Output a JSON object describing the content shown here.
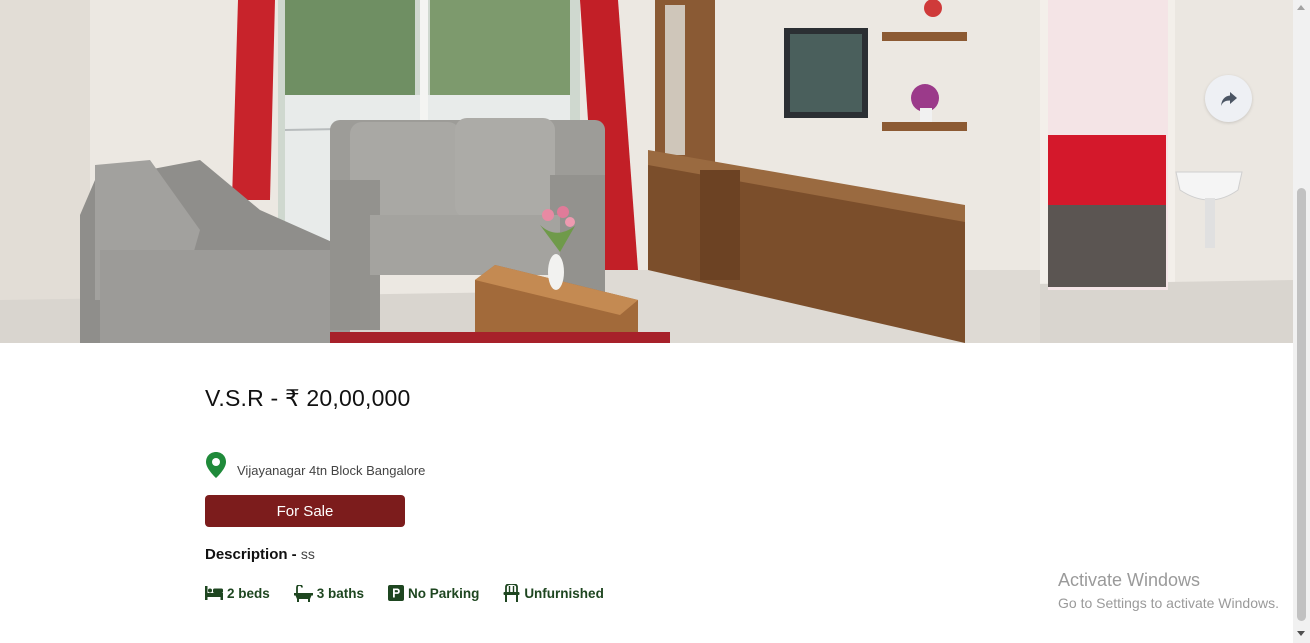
{
  "listing": {
    "title": "V.S.R - ₹ 20,00,000",
    "location": "Vijayanagar 4tn Block Bangalore",
    "status": "For Sale",
    "description_label": "Description",
    "description_separator": " - ",
    "description_value": "ss",
    "features": [
      {
        "icon": "bed-icon",
        "label": "2 beds"
      },
      {
        "icon": "bath-icon",
        "label": "3 baths"
      },
      {
        "icon": "parking-icon",
        "label": "No Parking"
      },
      {
        "icon": "chair-icon",
        "label": "Unfurnished"
      }
    ]
  },
  "hero": {
    "image": "living-room-photo",
    "share_icon": "share-icon"
  },
  "watermark": {
    "title": "Activate Windows",
    "subtitle": "Go to Settings to activate Windows."
  },
  "colors": {
    "accent": "#7c1c1c",
    "feature_text": "#1e4620",
    "pin": "#1f8a3a"
  }
}
